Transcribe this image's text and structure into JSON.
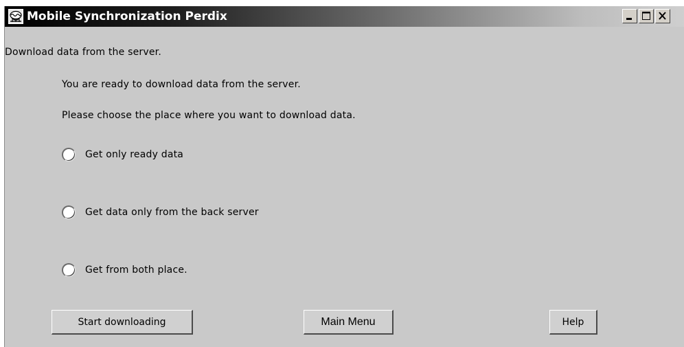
{
  "window": {
    "title": "Mobile Synchronization Perdix",
    "app_icon": "app-menu-icon",
    "controls": {
      "minimize_icon": "minimize-icon",
      "maximize_icon": "maximize-icon",
      "close_icon": "close-icon"
    }
  },
  "content": {
    "section_title": "Download data from the server.",
    "info_line_1": "You are ready to download data from the server.",
    "info_line_2": "Please choose the place where you want to download data.",
    "options": [
      {
        "label": "Get only ready data",
        "selected": false
      },
      {
        "label": "Get data only from the back server",
        "selected": false
      },
      {
        "label": "Get from both place.",
        "selected": false
      }
    ]
  },
  "buttons": {
    "start_label": "Start downloading",
    "main_menu_label": "Main Menu",
    "help_label": "Help"
  },
  "colors": {
    "window_bg": "#c9c9c9",
    "title_text": "#ffffff"
  }
}
